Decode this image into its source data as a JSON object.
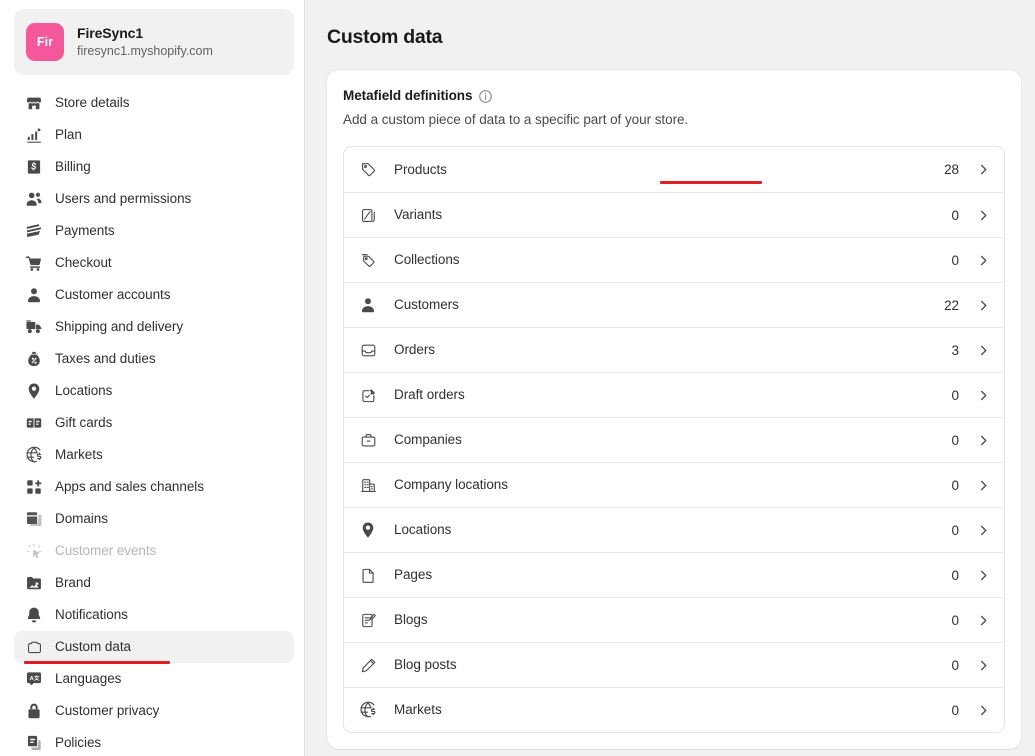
{
  "sidebar": {
    "store": {
      "avatar_initials": "Fir",
      "avatar_color": "#f4579a",
      "name": "FireSync1",
      "domain": "firesync1.myshopify.com"
    },
    "items": [
      {
        "label": "Store details",
        "icon": "store-icon",
        "state": "default"
      },
      {
        "label": "Plan",
        "icon": "plan-icon",
        "state": "default"
      },
      {
        "label": "Billing",
        "icon": "billing-icon",
        "state": "default"
      },
      {
        "label": "Users and permissions",
        "icon": "users-icon",
        "state": "default"
      },
      {
        "label": "Payments",
        "icon": "payments-icon",
        "state": "default"
      },
      {
        "label": "Checkout",
        "icon": "cart-icon",
        "state": "default"
      },
      {
        "label": "Customer accounts",
        "icon": "person-icon",
        "state": "default"
      },
      {
        "label": "Shipping and delivery",
        "icon": "truck-icon",
        "state": "default"
      },
      {
        "label": "Taxes and duties",
        "icon": "taxes-icon",
        "state": "default"
      },
      {
        "label": "Locations",
        "icon": "location-pin-icon",
        "state": "default"
      },
      {
        "label": "Gift cards",
        "icon": "gift-card-icon",
        "state": "default"
      },
      {
        "label": "Markets",
        "icon": "globe-dollar-icon",
        "state": "default"
      },
      {
        "label": "Apps and sales channels",
        "icon": "apps-icon",
        "state": "default"
      },
      {
        "label": "Domains",
        "icon": "domains-icon",
        "state": "default"
      },
      {
        "label": "Customer events",
        "icon": "customer-events-icon",
        "state": "disabled"
      },
      {
        "label": "Brand",
        "icon": "brand-icon",
        "state": "default"
      },
      {
        "label": "Notifications",
        "icon": "bell-icon",
        "state": "default"
      },
      {
        "label": "Custom data",
        "icon": "custom-data-icon",
        "state": "selected"
      },
      {
        "label": "Languages",
        "icon": "languages-icon",
        "state": "default"
      },
      {
        "label": "Customer privacy",
        "icon": "lock-icon",
        "state": "default"
      },
      {
        "label": "Policies",
        "icon": "policies-icon",
        "state": "default"
      }
    ]
  },
  "main": {
    "page_title": "Custom data",
    "card": {
      "title": "Metafield definitions",
      "info_icon": "info-icon",
      "subtitle": "Add a custom piece of data to a specific part of your store.",
      "rows": [
        {
          "label": "Products",
          "count": "28",
          "icon": "tag-icon",
          "chevron": "chevron-right-icon"
        },
        {
          "label": "Variants",
          "count": "0",
          "icon": "variant-icon",
          "chevron": "chevron-right-icon"
        },
        {
          "label": "Collections",
          "count": "0",
          "icon": "collection-icon",
          "chevron": "chevron-right-icon"
        },
        {
          "label": "Customers",
          "count": "22",
          "icon": "person-icon",
          "chevron": "chevron-right-icon"
        },
        {
          "label": "Orders",
          "count": "3",
          "icon": "order-icon",
          "chevron": "chevron-right-icon"
        },
        {
          "label": "Draft orders",
          "count": "0",
          "icon": "draft-order-icon",
          "chevron": "chevron-right-icon"
        },
        {
          "label": "Companies",
          "count": "0",
          "icon": "briefcase-icon",
          "chevron": "chevron-right-icon"
        },
        {
          "label": "Company locations",
          "count": "0",
          "icon": "building-icon",
          "chevron": "chevron-right-icon"
        },
        {
          "label": "Locations",
          "count": "0",
          "icon": "location-pin-icon",
          "chevron": "chevron-right-icon"
        },
        {
          "label": "Pages",
          "count": "0",
          "icon": "page-icon",
          "chevron": "chevron-right-icon"
        },
        {
          "label": "Blogs",
          "count": "0",
          "icon": "blog-icon",
          "chevron": "chevron-right-icon"
        },
        {
          "label": "Blog posts",
          "count": "0",
          "icon": "pencil-icon",
          "chevron": "chevron-right-icon"
        },
        {
          "label": "Markets",
          "count": "0",
          "icon": "globe-dollar-icon",
          "chevron": "chevron-right-icon"
        }
      ]
    }
  },
  "annotations": {
    "color": "#e02020",
    "underlines": [
      "sidebar-custom-data",
      "main-row-products"
    ]
  }
}
